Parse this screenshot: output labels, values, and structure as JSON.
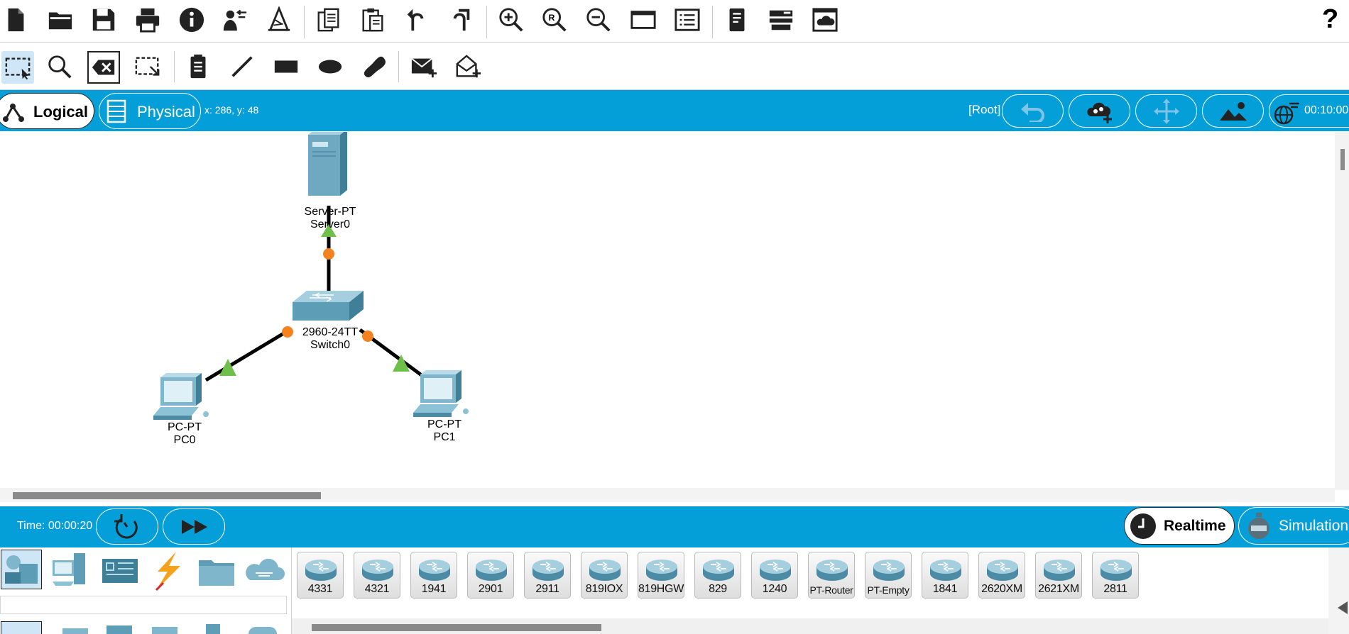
{
  "toolbar": {
    "help_label": "?"
  },
  "tabs": {
    "logical_label": "Logical",
    "physical_label": "Physical"
  },
  "coords_text": "x: 286, y: 48",
  "root_label": "[Root]",
  "clock_text": "00:10:00",
  "devices": {
    "server": {
      "model": "Server-PT",
      "name": "Server0"
    },
    "switch": {
      "model": "2960-24TT",
      "name": "Switch0"
    },
    "pc0": {
      "model": "PC-PT",
      "name": "PC0"
    },
    "pc1": {
      "model": "PC-PT",
      "name": "PC1"
    }
  },
  "timebar": {
    "time_text": "Time: 00:00:20",
    "realtime_label": "Realtime",
    "simulation_label": "Simulation"
  },
  "device_models": [
    "4331",
    "4321",
    "1941",
    "2901",
    "2911",
    "819IOX",
    "819HGW",
    "829",
    "1240",
    "PT-Router",
    "PT-Empty",
    "1841",
    "2620XM",
    "2621XM",
    "2811"
  ],
  "colors": {
    "accent_blue": "#049fd9",
    "device_teal": "#5d9db5",
    "link_up": "#6fc04a",
    "link_blocking": "#f5821f"
  }
}
